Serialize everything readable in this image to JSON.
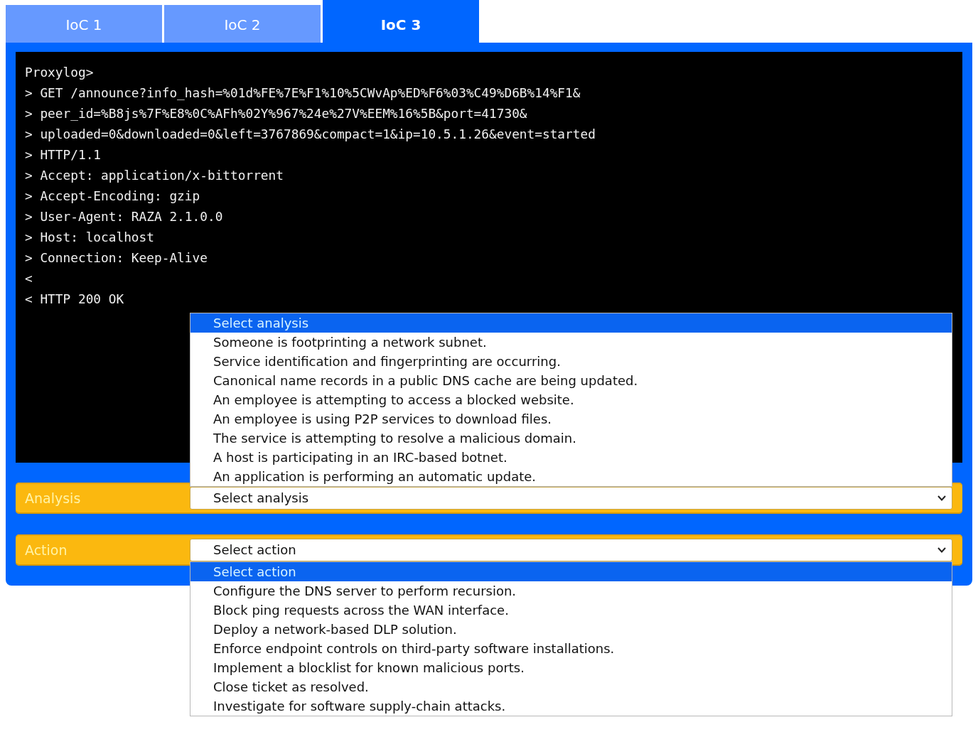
{
  "tabs": [
    {
      "label": "IoC 1",
      "selected": false
    },
    {
      "label": "IoC 2",
      "selected": false
    },
    {
      "label": "IoC 3",
      "selected": true
    }
  ],
  "terminal": {
    "lines": [
      "Proxylog>",
      "> GET /announce?info_hash=%01d%FE%7E%F1%10%5CWvAp%ED%F6%03%C49%D6B%14%F1&",
      "> peer_id=%B8js%7F%E8%0C%AFh%02Y%967%24e%27V%EEM%16%5B&port=41730&",
      "> uploaded=0&downloaded=0&left=3767869&compact=1&ip=10.5.1.26&event=started",
      "> HTTP/1.1",
      "> Accept: application/x-bittorrent",
      "> Accept-Encoding: gzip",
      "> User-Agent: RAZA 2.1.0.0",
      "> Host: localhost",
      "> Connection: Keep-Alive",
      "<",
      "< HTTP 200 OK"
    ]
  },
  "fields": [
    {
      "label": "Analysis",
      "value": "Select analysis",
      "expanded": true,
      "options": [
        {
          "label": "Select analysis",
          "selected": true
        },
        {
          "label": "Someone is footprinting a network subnet.",
          "selected": false
        },
        {
          "label": "Service identification and fingerprinting are occurring.",
          "selected": false
        },
        {
          "label": "Canonical name records in a public DNS cache are being updated.",
          "selected": false
        },
        {
          "label": "An employee is attempting to access a blocked website.",
          "selected": false
        },
        {
          "label": "An employee is using P2P services to download files.",
          "selected": false
        },
        {
          "label": "The service is attempting to resolve a malicious domain.",
          "selected": false
        },
        {
          "label": "A host is participating in an IRC-based botnet.",
          "selected": false
        },
        {
          "label": "An application is performing an automatic update.",
          "selected": false
        }
      ]
    },
    {
      "label": "Action",
      "value": "Select action",
      "expanded": true,
      "options": [
        {
          "label": "Select action",
          "selected": true
        },
        {
          "label": "Configure the DNS server to perform recursion.",
          "selected": false
        },
        {
          "label": "Block ping requests across the WAN interface.",
          "selected": false
        },
        {
          "label": "Deploy a network-based DLP solution.",
          "selected": false
        },
        {
          "label": "Enforce endpoint controls on third-party software installations.",
          "selected": false
        },
        {
          "label": "Implement a blocklist for known malicious ports.",
          "selected": false
        },
        {
          "label": "Close ticket as resolved.",
          "selected": false
        },
        {
          "label": "Investigate for software supply-chain attacks.",
          "selected": false
        }
      ]
    }
  ]
}
